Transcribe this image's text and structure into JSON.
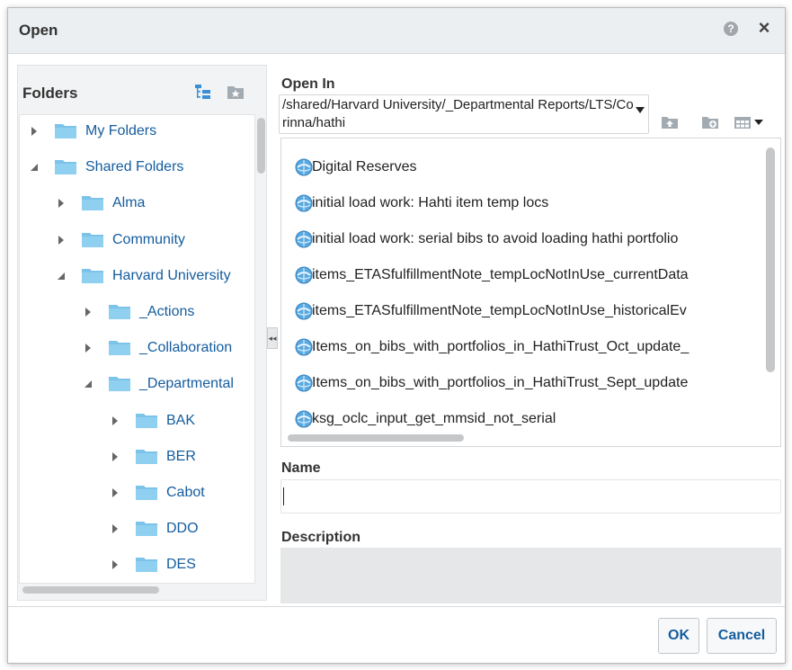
{
  "dialog": {
    "title": "Open",
    "help_icon": "help-circle-icon",
    "help_glyph": "?",
    "close_icon": "close-icon",
    "close_glyph": "×"
  },
  "folders": {
    "title": "Folders",
    "toolbar_icons": [
      "hierarchy-icon",
      "favorites-folder-icon"
    ],
    "tree": [
      {
        "label": "My Folders",
        "expanded": false
      },
      {
        "label": "Shared Folders",
        "expanded": true
      },
      {
        "label": "Alma",
        "expanded": false
      },
      {
        "label": "Community",
        "expanded": false
      },
      {
        "label": "Harvard University",
        "expanded": true
      },
      {
        "label": "_Actions",
        "expanded": false
      },
      {
        "label": "_Collaboration",
        "expanded": false
      },
      {
        "label": "_Departmental",
        "expanded": true
      },
      {
        "label": "BAK",
        "expanded": false
      },
      {
        "label": "BER",
        "expanded": false
      },
      {
        "label": "Cabot",
        "expanded": false
      },
      {
        "label": "DDO",
        "expanded": false
      },
      {
        "label": "DES",
        "expanded": false
      }
    ]
  },
  "open_in": {
    "label": "Open In",
    "path": "/shared/Harvard University/_Departmental Reports/LTS/Corinna/hathi",
    "toolbar_icons": [
      "up-folder-icon",
      "new-folder-icon",
      "view-options-icon"
    ]
  },
  "items": [
    {
      "label": "Digital Reserves"
    },
    {
      "label": "initial load work: Hahti item temp locs"
    },
    {
      "label": "initial load work: serial bibs to avoid loading hathi portfolio"
    },
    {
      "label": "items_ETASfulfillmentNote_tempLocNotInUse_currentData"
    },
    {
      "label": "items_ETASfulfillmentNote_tempLocNotInUse_historicalEv"
    },
    {
      "label": "Items_on_bibs_with_portfolios_in_HathiTrust_Oct_update_"
    },
    {
      "label": "Items_on_bibs_with_portfolios_in_HathiTrust_Sept_update"
    },
    {
      "label": "ksg_oclc_input_get_mmsid_not_serial"
    }
  ],
  "name": {
    "label": "Name",
    "value": ""
  },
  "description": {
    "label": "Description",
    "value": ""
  },
  "buttons": {
    "ok": "OK",
    "cancel": "Cancel"
  },
  "colors": {
    "link": "#145c9e",
    "folder": "#7cc3ea",
    "header_bg": "#eceff2"
  }
}
